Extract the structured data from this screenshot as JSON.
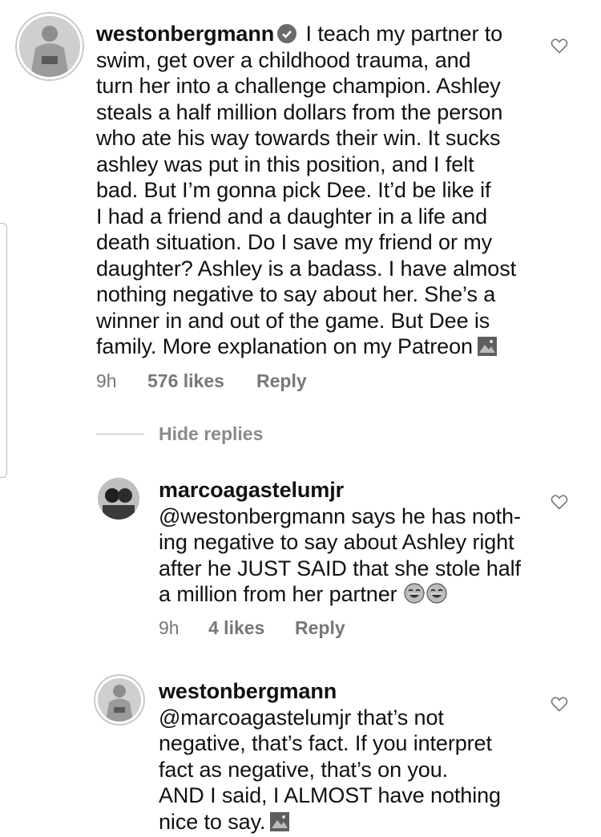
{
  "comments": [
    {
      "username": "westonbergmann",
      "verified": true,
      "text_lines": [
        "I teach my partner to",
        "swim, get over a childhood trauma, and",
        "turn her into a challenge champion. Ashley",
        "steals a half million dollars from the person",
        "who ate his way towards their win. It sucks",
        "ashley was put in this position, and I felt",
        "bad. But I’m gonna pick Dee. It’d be like if",
        "I had a friend and a daughter in a life and",
        "death situation. Do I save my friend or my",
        "daughter? Ashley is a badass. I have almost",
        "nothing negative to say about her. She’s a",
        "winner in and out of the game. But Dee is",
        "family. More explanation on my Patreon"
      ],
      "time": "9h",
      "likes": "576 likes",
      "reply": "Reply"
    },
    {
      "username": "marcoagastelumjr",
      "text_lines": [
        "@westonbergmann says he has noth-",
        "ing negative to say about Ashley right",
        "after he JUST SAID that she stole half",
        "a million from her partner"
      ],
      "time": "9h",
      "likes": "4 likes",
      "reply": "Reply"
    },
    {
      "username": "westonbergmann",
      "text_lines": [
        "@marcoagastelumjr that’s not",
        "negative, that’s fact. If you interpret",
        "fact as negative, that’s on you.",
        "AND I said, I ALMOST have nothing",
        "nice to say."
      ]
    }
  ],
  "hide_replies": "Hide replies",
  "icons": {
    "heart": "heart-outline-icon",
    "verified": "verified-badge-icon",
    "emoji": "tears-of-joy-emoji",
    "sticker": "image-sticker-icon"
  }
}
